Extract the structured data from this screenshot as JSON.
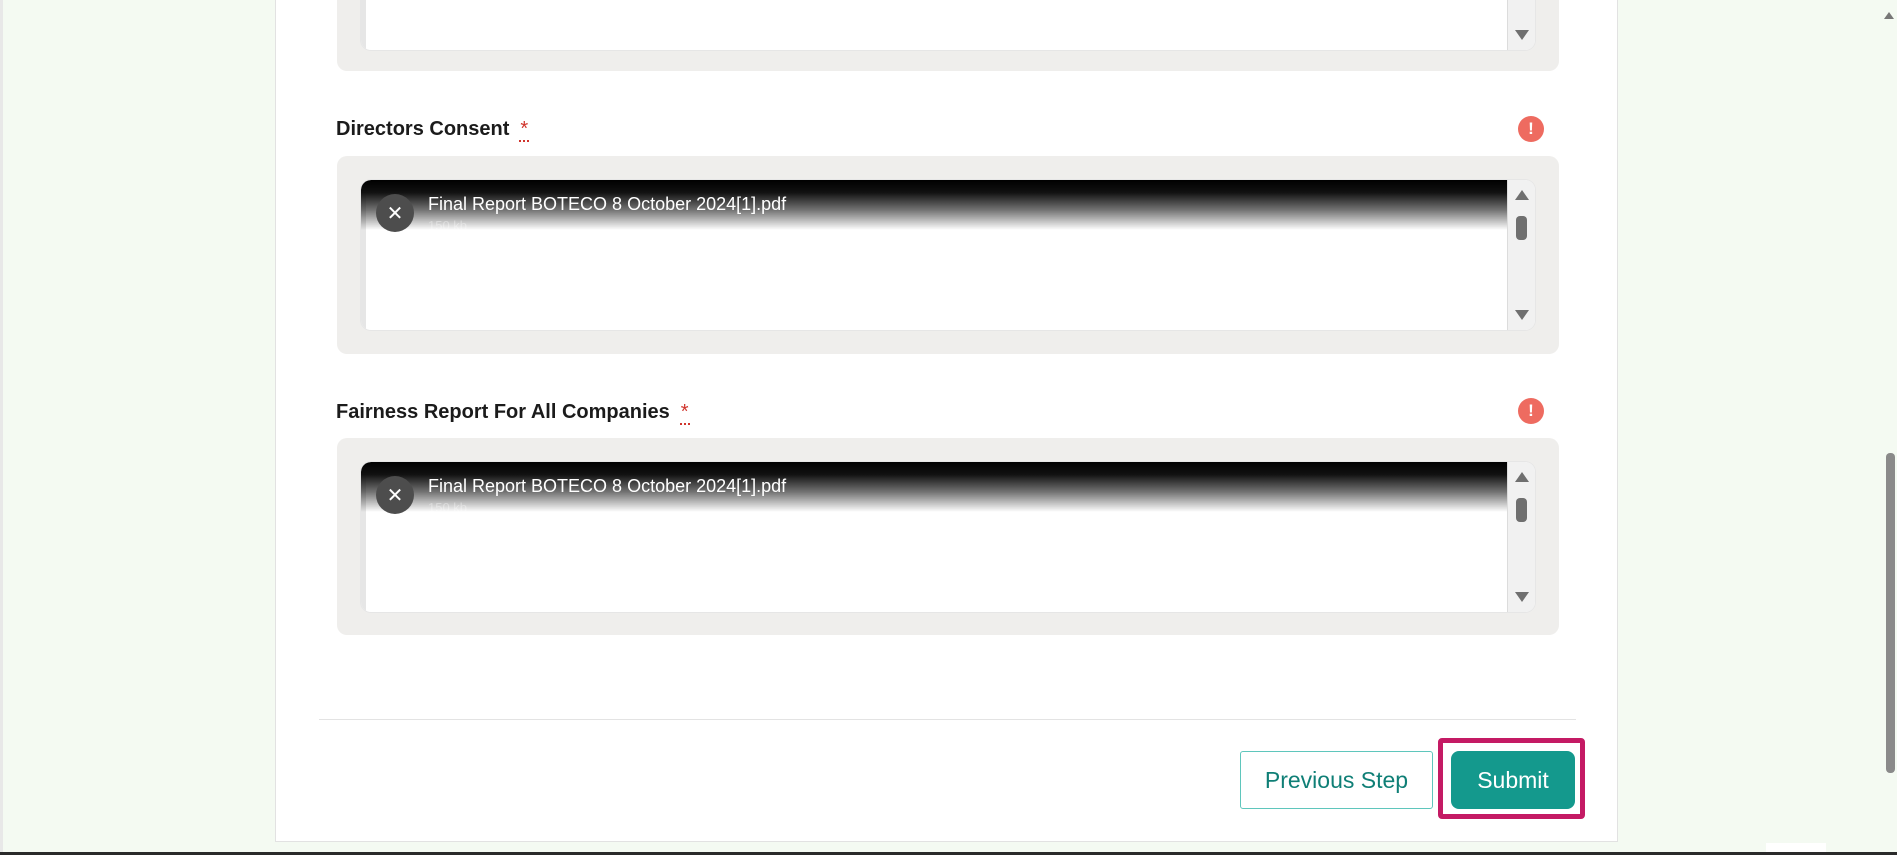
{
  "fields": [
    {
      "label": "Directors Consent",
      "required_marker": "*",
      "error_icon": "!",
      "file": {
        "name": "Final Report BOTECO 8 October 2024[1].pdf",
        "size": "150 kb"
      },
      "remove_icon": "✕"
    },
    {
      "label": "Fairness Report For All Companies",
      "required_marker": "*",
      "error_icon": "!",
      "file": {
        "name": "Final Report BOTECO 8 October 2024[1].pdf",
        "size": "150 kb"
      },
      "remove_icon": "✕"
    }
  ],
  "actions": {
    "previous_label": "Previous Step",
    "submit_label": "Submit"
  },
  "colors": {
    "accent": "#14998d",
    "highlight": "#c41a64",
    "error": "#ee6b60",
    "page_background": "#f4faf2"
  }
}
